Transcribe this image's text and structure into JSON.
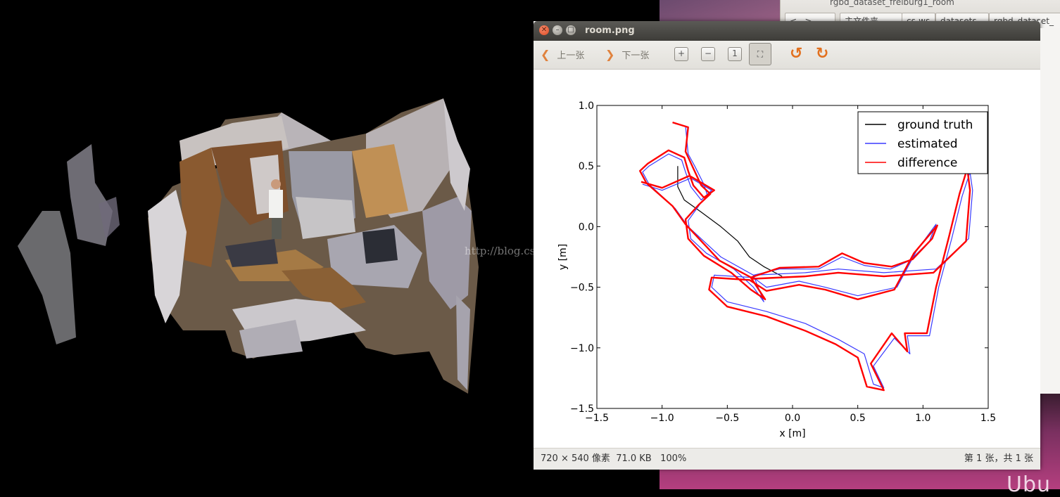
{
  "background_window": {
    "title": "rgbd_dataset_freiburg1_room",
    "path_segments": [
      "主文件夹",
      "cs-ws",
      "datasets",
      "rgbd_dataset_"
    ],
    "edge_letter": "a"
  },
  "desktop": {
    "ubuntu_text": "Ubu"
  },
  "watermark": "http://blog.csdn.net/",
  "viewer": {
    "title": "room.png",
    "toolbar": {
      "prev_label": "上一张",
      "next_label": "下一张",
      "icons": [
        "zoom-in-icon",
        "zoom-out-icon",
        "original-size-icon",
        "best-fit-icon",
        "rotate-left-icon",
        "rotate-right-icon"
      ]
    },
    "status": {
      "dimensions": "720 × 540 像素",
      "size": "71.0 KB",
      "zoom": "100%",
      "page": "第 1 张，共 1 张"
    }
  },
  "chart_data": {
    "type": "line",
    "xlabel": "x [m]",
    "ylabel": "y [m]",
    "xlim": [
      -1.5,
      1.5
    ],
    "ylim": [
      -1.5,
      1.0
    ],
    "xticks": [
      "−1.5",
      "−1.0",
      "−0.5",
      "0.0",
      "0.5",
      "1.0",
      "1.5"
    ],
    "yticks": [
      "−1.5",
      "−1.0",
      "−0.5",
      "0.0",
      "0.5",
      "1.0"
    ],
    "legend_position": "top-right",
    "grid": false,
    "series": [
      {
        "name": "ground truth",
        "color": "#000000",
        "points": [
          [
            -0.88,
            0.5
          ],
          [
            -0.88,
            0.33
          ],
          [
            -0.83,
            0.22
          ],
          [
            -0.7,
            0.12
          ],
          [
            -0.55,
            0.0
          ],
          [
            -0.42,
            -0.12
          ],
          [
            -0.33,
            -0.25
          ],
          [
            -0.22,
            -0.33
          ],
          [
            -0.08,
            -0.41
          ]
        ]
      },
      {
        "name": "estimated",
        "color": "#3a3aff",
        "points": [
          [
            -0.9,
            0.85
          ],
          [
            -0.82,
            0.83
          ],
          [
            -0.8,
            0.6
          ],
          [
            -0.75,
            0.5
          ],
          [
            -0.68,
            0.35
          ],
          [
            -0.65,
            0.25
          ],
          [
            -0.7,
            0.2
          ],
          [
            -0.8,
            0.05
          ],
          [
            -0.78,
            -0.1
          ],
          [
            -0.66,
            -0.22
          ],
          [
            -0.45,
            -0.35
          ],
          [
            -0.3,
            -0.5
          ],
          [
            -0.22,
            -0.62
          ],
          [
            -0.3,
            -0.4
          ],
          [
            -0.1,
            -0.35
          ],
          [
            0.2,
            -0.35
          ],
          [
            0.38,
            -0.25
          ],
          [
            0.55,
            -0.32
          ],
          [
            0.75,
            -0.35
          ],
          [
            0.9,
            -0.28
          ],
          [
            1.05,
            -0.12
          ],
          [
            1.1,
            0.02
          ],
          [
            0.95,
            -0.2
          ],
          [
            0.8,
            -0.5
          ],
          [
            0.5,
            -0.57
          ],
          [
            0.25,
            -0.5
          ],
          [
            0.05,
            -0.45
          ],
          [
            -0.2,
            -0.5
          ],
          [
            -0.3,
            -0.42
          ],
          [
            -0.6,
            -0.4
          ],
          [
            -0.62,
            -0.5
          ],
          [
            -0.5,
            -0.62
          ],
          [
            -0.2,
            -0.7
          ],
          [
            0.1,
            -0.8
          ],
          [
            0.35,
            -0.93
          ],
          [
            0.55,
            -1.05
          ],
          [
            0.62,
            -1.3
          ],
          [
            0.7,
            -1.33
          ],
          [
            0.62,
            -1.15
          ],
          [
            0.78,
            -0.92
          ],
          [
            0.9,
            -1.05
          ],
          [
            0.88,
            -0.9
          ],
          [
            1.05,
            -0.9
          ],
          [
            1.12,
            -0.5
          ],
          [
            1.22,
            -0.1
          ],
          [
            1.3,
            0.25
          ],
          [
            1.36,
            0.45
          ],
          [
            1.38,
            0.3
          ],
          [
            1.35,
            -0.1
          ],
          [
            1.1,
            -0.35
          ],
          [
            0.7,
            -0.38
          ],
          [
            0.35,
            -0.35
          ],
          [
            0.1,
            -0.38
          ],
          [
            -0.3,
            -0.4
          ],
          [
            -0.55,
            -0.25
          ],
          [
            -0.8,
            0.0
          ],
          [
            -0.9,
            0.15
          ],
          [
            -1.1,
            0.35
          ],
          [
            -1.15,
            0.45
          ],
          [
            -1.1,
            0.5
          ],
          [
            -0.95,
            0.6
          ],
          [
            -0.85,
            0.55
          ],
          [
            -0.82,
            0.45
          ],
          [
            -0.78,
            0.33
          ],
          [
            -0.7,
            0.22
          ],
          [
            -0.62,
            0.3
          ],
          [
            -0.78,
            0.4
          ],
          [
            -1.0,
            0.3
          ],
          [
            -1.15,
            0.35
          ]
        ]
      },
      {
        "name": "difference",
        "color": "#ff0000",
        "points": [
          [
            -0.92,
            0.86
          ],
          [
            -0.8,
            0.82
          ],
          [
            -0.82,
            0.62
          ],
          [
            -0.76,
            0.48
          ],
          [
            -0.7,
            0.34
          ],
          [
            -0.63,
            0.27
          ],
          [
            -0.72,
            0.18
          ],
          [
            -0.82,
            0.06
          ],
          [
            -0.8,
            -0.1
          ],
          [
            -0.68,
            -0.24
          ],
          [
            -0.47,
            -0.38
          ],
          [
            -0.32,
            -0.52
          ],
          [
            -0.21,
            -0.6
          ],
          [
            -0.32,
            -0.42
          ],
          [
            -0.1,
            -0.34
          ],
          [
            0.2,
            -0.33
          ],
          [
            0.38,
            -0.22
          ],
          [
            0.55,
            -0.3
          ],
          [
            0.76,
            -0.33
          ],
          [
            0.92,
            -0.27
          ],
          [
            1.07,
            -0.1
          ],
          [
            1.11,
            0.01
          ],
          [
            0.93,
            -0.22
          ],
          [
            0.78,
            -0.52
          ],
          [
            0.5,
            -0.6
          ],
          [
            0.25,
            -0.52
          ],
          [
            0.05,
            -0.48
          ],
          [
            -0.2,
            -0.53
          ],
          [
            -0.33,
            -0.44
          ],
          [
            -0.62,
            -0.42
          ],
          [
            -0.64,
            -0.52
          ],
          [
            -0.5,
            -0.66
          ],
          [
            -0.2,
            -0.74
          ],
          [
            0.1,
            -0.86
          ],
          [
            0.33,
            -0.97
          ],
          [
            0.5,
            -1.08
          ],
          [
            0.57,
            -1.32
          ],
          [
            0.7,
            -1.35
          ],
          [
            0.6,
            -1.13
          ],
          [
            0.76,
            -0.88
          ],
          [
            0.88,
            -1.03
          ],
          [
            0.86,
            -0.88
          ],
          [
            1.03,
            -0.88
          ],
          [
            1.1,
            -0.5
          ],
          [
            1.2,
            -0.08
          ],
          [
            1.28,
            0.27
          ],
          [
            1.34,
            0.48
          ],
          [
            1.36,
            0.3
          ],
          [
            1.33,
            -0.12
          ],
          [
            1.08,
            -0.38
          ],
          [
            0.7,
            -0.41
          ],
          [
            0.35,
            -0.38
          ],
          [
            0.1,
            -0.41
          ],
          [
            -0.3,
            -0.43
          ],
          [
            -0.56,
            -0.28
          ],
          [
            -0.82,
            0.02
          ],
          [
            -0.92,
            0.17
          ],
          [
            -1.12,
            0.36
          ],
          [
            -1.17,
            0.46
          ],
          [
            -1.11,
            0.52
          ],
          [
            -0.95,
            0.63
          ],
          [
            -0.83,
            0.57
          ],
          [
            -0.8,
            0.46
          ],
          [
            -0.76,
            0.34
          ],
          [
            -0.68,
            0.24
          ],
          [
            -0.6,
            0.3
          ],
          [
            -0.79,
            0.42
          ],
          [
            -1.0,
            0.32
          ],
          [
            -1.16,
            0.37
          ]
        ]
      }
    ]
  }
}
